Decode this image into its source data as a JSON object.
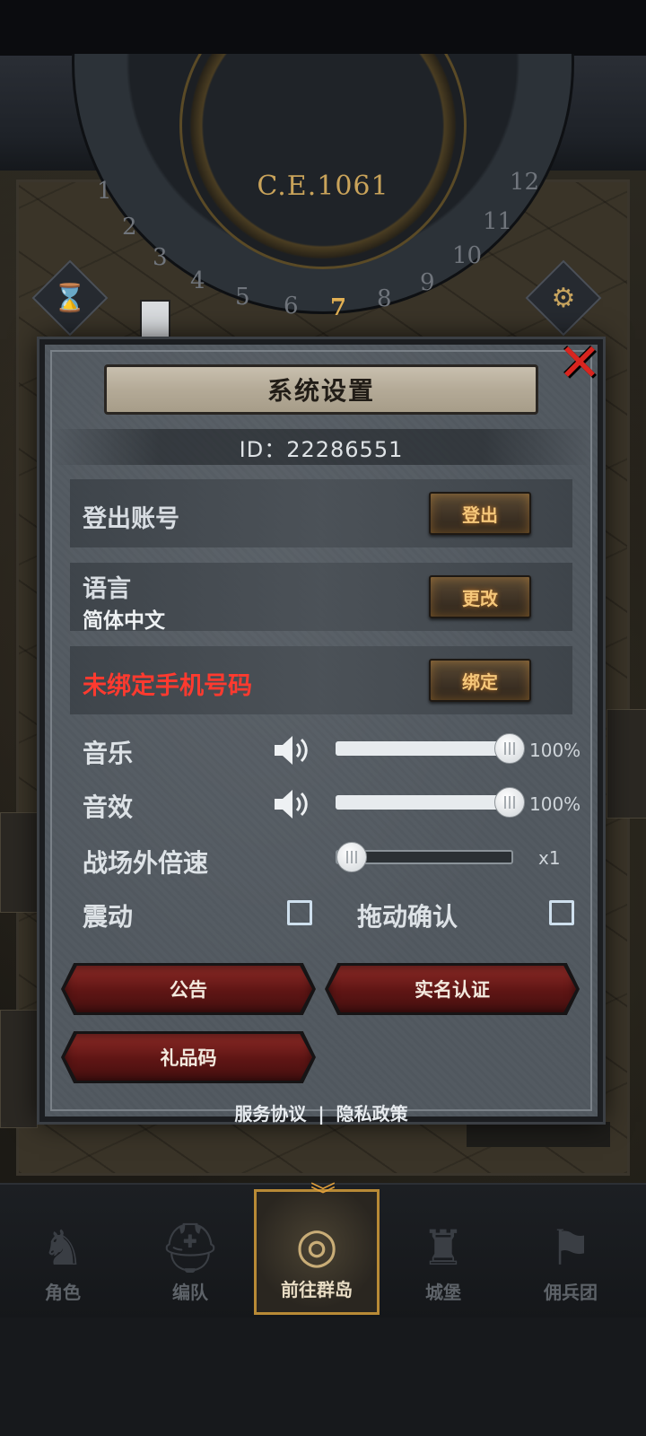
{
  "game": {
    "year": "C.E.1061",
    "dial_numbers": [
      "1",
      "2",
      "3",
      "4",
      "5",
      "6",
      "7",
      "8",
      "9",
      "10",
      "11",
      "12"
    ],
    "active_number": "7"
  },
  "dialog": {
    "title": "系统设置",
    "id_text": "ID：22286551",
    "logout": {
      "label": "登出账号",
      "button": "登出"
    },
    "language": {
      "label": "语言",
      "value": "简体中文",
      "button": "更改"
    },
    "phone": {
      "label": "未绑定手机号码",
      "button": "绑定"
    },
    "music": {
      "label": "音乐",
      "value_text": "100%",
      "level": 1.0
    },
    "sfx": {
      "label": "音效",
      "value_text": "100%",
      "level": 1.0
    },
    "speed": {
      "label": "战场外倍速",
      "value_text": "x1",
      "level": 0.0
    },
    "vibrate": {
      "label": "震动",
      "checked": false
    },
    "drag_confirm": {
      "label": "拖动确认",
      "checked": false
    },
    "buttons": {
      "announcement": "公告",
      "real_name": "实名认证",
      "gift_code": "礼品码"
    },
    "footer": {
      "service": "服务协议",
      "separator": "|",
      "privacy": "隐私政策"
    }
  },
  "nav": {
    "items": [
      {
        "label": "角色",
        "icon": "knight-icon"
      },
      {
        "label": "编队",
        "icon": "helmet-icon"
      },
      {
        "label": "前往群岛",
        "icon": "globe-icon",
        "active": true
      },
      {
        "label": "城堡",
        "icon": "castle-icon"
      },
      {
        "label": "佣兵团",
        "icon": "banner-icon"
      }
    ]
  },
  "colors": {
    "warning_red": "#ff3a2f",
    "accent_gold": "#c9a35a",
    "close_red": "#d8251f"
  }
}
